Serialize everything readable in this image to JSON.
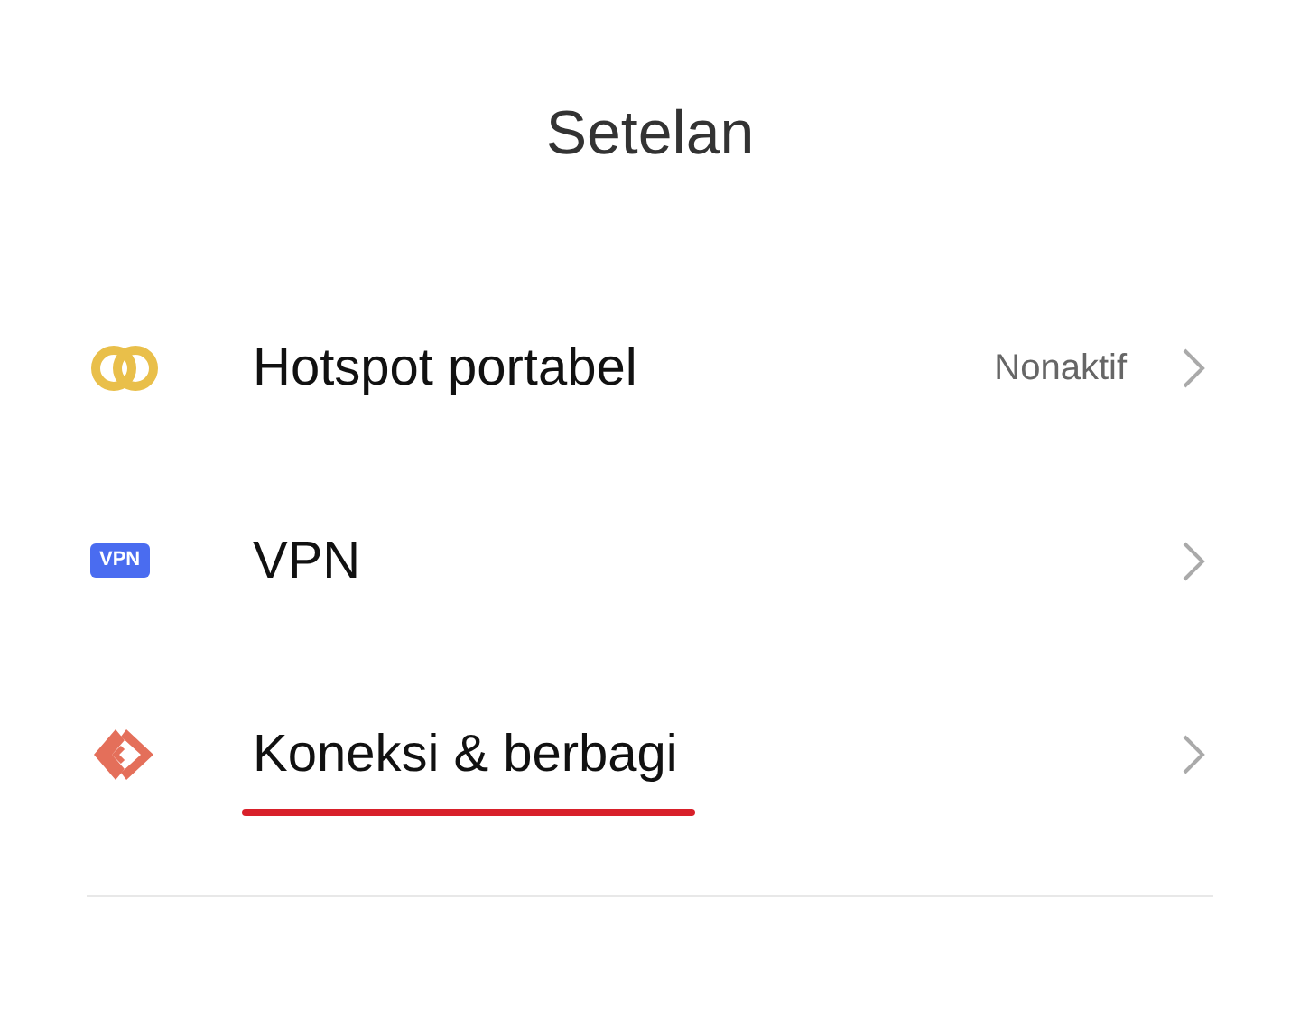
{
  "title": "Setelan",
  "items": [
    {
      "kind": "rings",
      "label": "Hotspot portabel",
      "value": "Nonaktif",
      "highlighted": false
    },
    {
      "kind": "badge",
      "badge_text": "VPN",
      "label": "VPN",
      "highlighted": false
    },
    {
      "kind": "share",
      "label": "Koneksi & berbagi",
      "highlighted": true
    }
  ]
}
